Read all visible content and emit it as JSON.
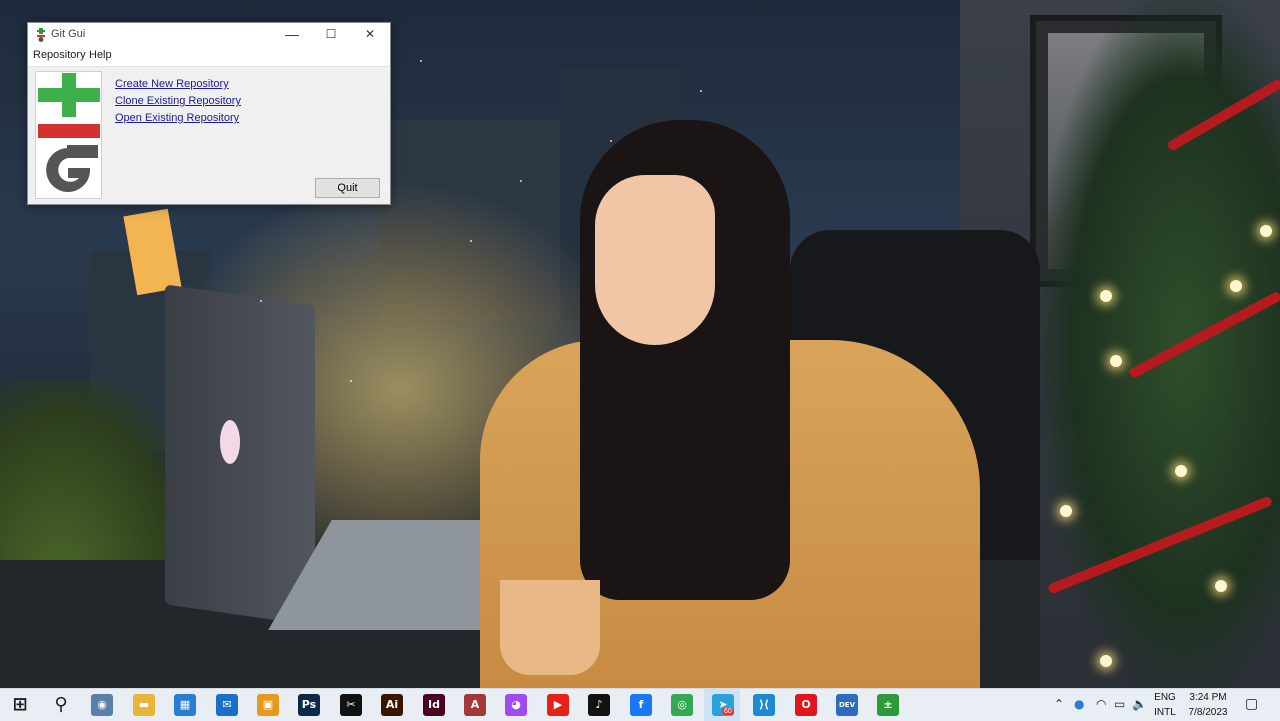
{
  "window": {
    "title": "Git Gui",
    "controls": {
      "minimize": "—",
      "maximize": "☐",
      "close": "✕"
    },
    "menu": [
      "Repository",
      "Help"
    ],
    "links": [
      "Create New Repository",
      "Clone Existing Repository",
      "Open Existing Repository"
    ],
    "quit_label": "Quit"
  },
  "taskbar": {
    "apps": [
      {
        "name": "start-icon",
        "glyph": "⊞",
        "color": "#1e1e1e"
      },
      {
        "name": "search-icon",
        "glyph": "⚲",
        "color": "#1e1e1e"
      },
      {
        "name": "camera-icon",
        "glyph": "◉",
        "color": "#5a7fa8"
      },
      {
        "name": "file-explorer-icon",
        "glyph": "▬",
        "color": "#e8b43a"
      },
      {
        "name": "store-icon",
        "glyph": "▦",
        "color": "#2b7cd3"
      },
      {
        "name": "mail-icon",
        "glyph": "✉",
        "color": "#1a6fc9"
      },
      {
        "name": "remote-icon",
        "glyph": "▣",
        "color": "#e59a1f"
      },
      {
        "name": "photoshop-icon",
        "glyph": "Ps",
        "color": "#0b2a4a"
      },
      {
        "name": "capcut-icon",
        "glyph": "✂",
        "color": "#111111"
      },
      {
        "name": "illustrator-icon",
        "glyph": "Ai",
        "color": "#3a1600"
      },
      {
        "name": "indesign-icon",
        "glyph": "Id",
        "color": "#49021f"
      },
      {
        "name": "access-icon",
        "glyph": "A",
        "color": "#a4373a"
      },
      {
        "name": "messenger-icon",
        "glyph": "◕",
        "color": "#a04bf0"
      },
      {
        "name": "youtube-icon",
        "glyph": "▶",
        "color": "#e62117"
      },
      {
        "name": "tiktok-icon",
        "glyph": "♪",
        "color": "#111111"
      },
      {
        "name": "facebook-icon",
        "glyph": "f",
        "color": "#1877f2"
      },
      {
        "name": "chrome-icon",
        "glyph": "◎",
        "color": "#34a853"
      },
      {
        "name": "telegram-icon",
        "glyph": "➤",
        "color": "#2aa1da"
      },
      {
        "name": "vscode-icon",
        "glyph": "⟩⟨",
        "color": "#1f8ad2"
      },
      {
        "name": "opera-icon",
        "glyph": "O",
        "color": "#e0161e"
      },
      {
        "name": "dev-icon",
        "glyph": "DEV",
        "color": "#2d6bbf"
      },
      {
        "name": "git-gui-icon",
        "glyph": "±",
        "color": "#2c9a3a"
      }
    ],
    "telegram_badge": "60",
    "tray": {
      "language": "ENG",
      "layout": "INTL",
      "time": "3:24 PM",
      "date": "7/8/2023"
    }
  }
}
